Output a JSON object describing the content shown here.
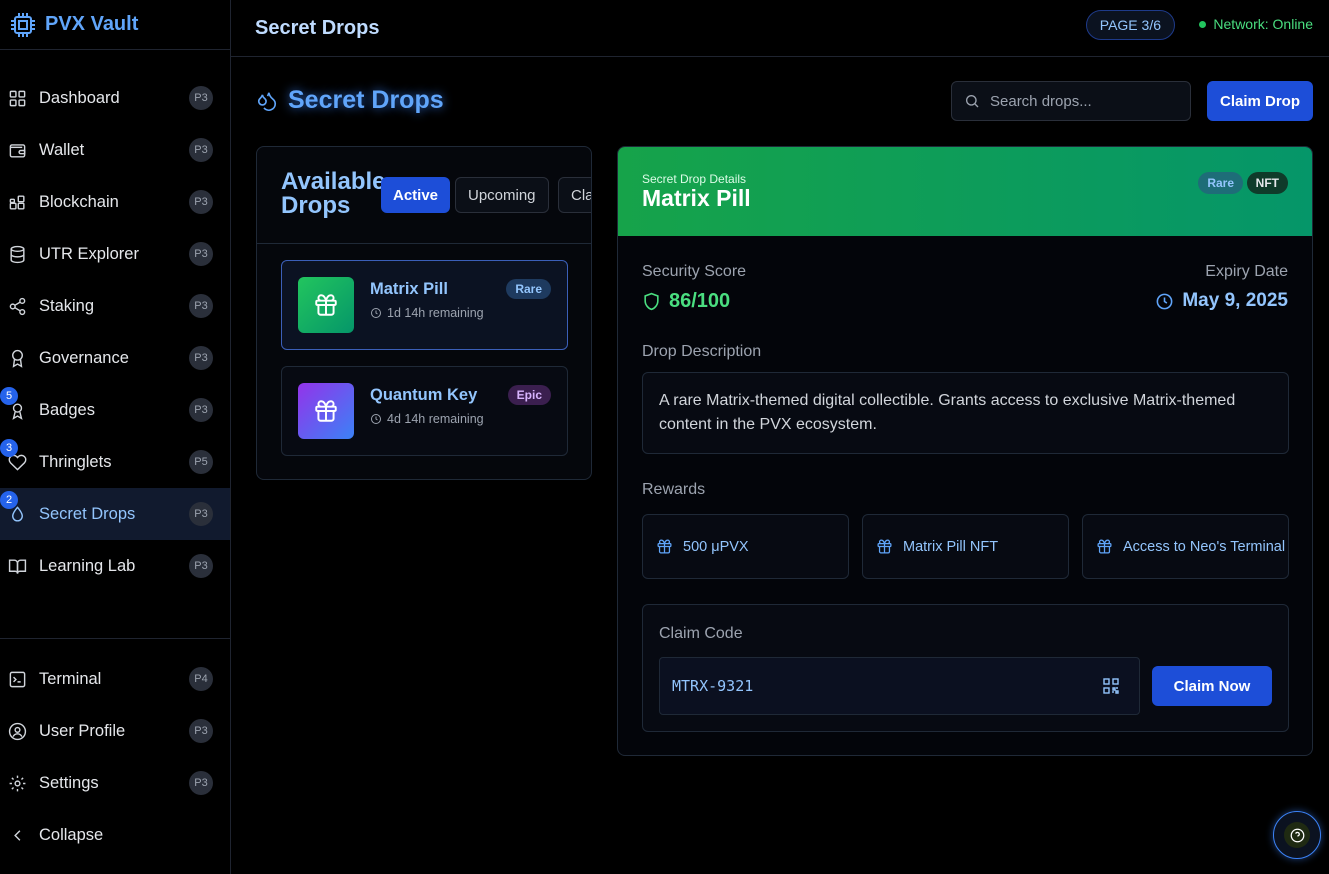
{
  "app": {
    "title": "PVX Vault"
  },
  "topbar": {
    "title": "Secret Drops",
    "page_badge": "PAGE 3/6",
    "network_status": "Network: Online"
  },
  "sidebar": {
    "items": [
      {
        "label": "Dashboard",
        "pill": "P3",
        "icon": "grid-icon"
      },
      {
        "label": "Wallet",
        "pill": "P3",
        "icon": "wallet-icon"
      },
      {
        "label": "Blockchain",
        "pill": "P3",
        "icon": "blocks-icon"
      },
      {
        "label": "UTR Explorer",
        "pill": "P3",
        "icon": "database-icon"
      },
      {
        "label": "Staking",
        "pill": "P3",
        "icon": "share-icon"
      },
      {
        "label": "Governance",
        "pill": "P3",
        "icon": "award-icon"
      },
      {
        "label": "Badges",
        "pill": "P3",
        "count": "5",
        "icon": "badge-icon"
      },
      {
        "label": "Thringlets",
        "pill": "P5",
        "count": "3",
        "icon": "heart-icon"
      },
      {
        "label": "Secret Drops",
        "pill": "P3",
        "count": "2",
        "icon": "droplet-icon"
      },
      {
        "label": "Learning Lab",
        "pill": "P3",
        "icon": "book-icon"
      }
    ],
    "bottom": [
      {
        "label": "Terminal",
        "pill": "P4",
        "icon": "terminal-icon"
      },
      {
        "label": "User Profile",
        "pill": "P3",
        "icon": "user-icon"
      },
      {
        "label": "Settings",
        "pill": "P3",
        "icon": "gear-icon"
      },
      {
        "label": "Collapse",
        "icon": "chevron-left-icon"
      }
    ]
  },
  "main": {
    "title": "Secret Drops",
    "search_placeholder": "Search drops...",
    "claim_drop_label": "Claim Drop"
  },
  "drops_panel": {
    "title": "Available Drops",
    "tabs": [
      "Active",
      "Upcoming",
      "Claimed"
    ],
    "drops": [
      {
        "name": "Matrix Pill",
        "time": "1d 14h remaining",
        "rarity": "Rare"
      },
      {
        "name": "Quantum Key",
        "time": "4d 14h remaining",
        "rarity": "Epic"
      }
    ]
  },
  "detail": {
    "subtitle": "Secret Drop Details",
    "name": "Matrix Pill",
    "rarity": "Rare",
    "type_chip": "NFT",
    "security_label": "Security Score",
    "security_value": "86/100",
    "expiry_label": "Expiry Date",
    "expiry_value": "May 9, 2025",
    "description_label": "Drop Description",
    "description": "A rare Matrix-themed digital collectible. Grants access to exclusive Matrix-themed content in the PVX ecosystem.",
    "rewards_label": "Rewards",
    "rewards": [
      "500 μPVX",
      "Matrix Pill NFT",
      "Access to Neo's Terminal"
    ],
    "claim_code_label": "Claim Code",
    "claim_code": "MTRX-9321",
    "claim_now_label": "Claim Now"
  },
  "colors": {
    "accent": "#1d4ed8",
    "link": "#93c5fd",
    "success": "#4ade80",
    "header_gradient_start": "#16a34a",
    "header_gradient_end": "#059669"
  }
}
